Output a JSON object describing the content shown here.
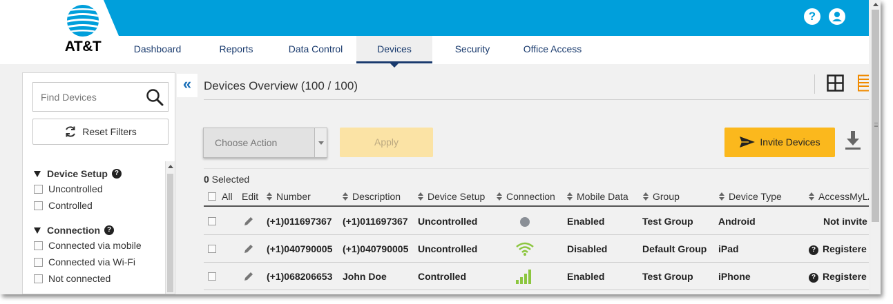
{
  "brand": {
    "name": "AT&T",
    "color": "#009fdb"
  },
  "header": {
    "help_icon": "?",
    "user_icon": "user-icon"
  },
  "nav": {
    "tabs": [
      {
        "label": "Dashboard",
        "active": false
      },
      {
        "label": "Reports",
        "active": false
      },
      {
        "label": "Data Control",
        "active": false
      },
      {
        "label": "Devices",
        "active": true
      },
      {
        "label": "Security",
        "active": false
      },
      {
        "label": "Office Access",
        "active": false
      }
    ]
  },
  "sidebar": {
    "search_placeholder": "Find Devices",
    "reset_label": "Reset Filters",
    "groups": [
      {
        "title": "Device Setup",
        "options": [
          "Uncontrolled",
          "Controlled"
        ]
      },
      {
        "title": "Connection",
        "options": [
          "Connected via mobile",
          "Connected via Wi-Fi",
          "Not connected"
        ]
      }
    ]
  },
  "main": {
    "title": "Devices Overview (100 / 100)",
    "choose_action_placeholder": "Choose Action",
    "apply_label": "Apply",
    "invite_label": "Invite Devices",
    "selected_count": "0",
    "selected_label": " Selected"
  },
  "table": {
    "headers": {
      "all": "All",
      "edit": "Edit",
      "number": "Number",
      "description": "Description",
      "device_setup": "Device Setup",
      "connection": "Connection",
      "mobile_data": "Mobile Data",
      "group": "Group",
      "device_type": "Device Type",
      "access": "AccessMyLA"
    },
    "rows": [
      {
        "number": "(+1)011697367",
        "description": "(+1)011697367",
        "setup": "Uncontrolled",
        "connection": "not-connected",
        "mobile_data": "Enabled",
        "group": "Test Group",
        "type": "Android",
        "access": "Not invite",
        "access_icon": false
      },
      {
        "number": "(+1)040790005",
        "description": "(+1)040790005",
        "setup": "Uncontrolled",
        "connection": "wifi",
        "mobile_data": "Disabled",
        "group": "Default Group",
        "type": "iPad",
        "access": "Registere",
        "access_icon": true
      },
      {
        "number": "(+1)068206653",
        "description": "John Doe",
        "setup": "Controlled",
        "connection": "mobile",
        "mobile_data": "Enabled",
        "group": "Test Group",
        "type": "iPhone",
        "access": "Registere",
        "access_icon": true
      }
    ]
  },
  "colors": {
    "accent_yellow": "#fbb81d",
    "nav_blue": "#1a3b6e",
    "signal_green": "#8cc63f"
  }
}
